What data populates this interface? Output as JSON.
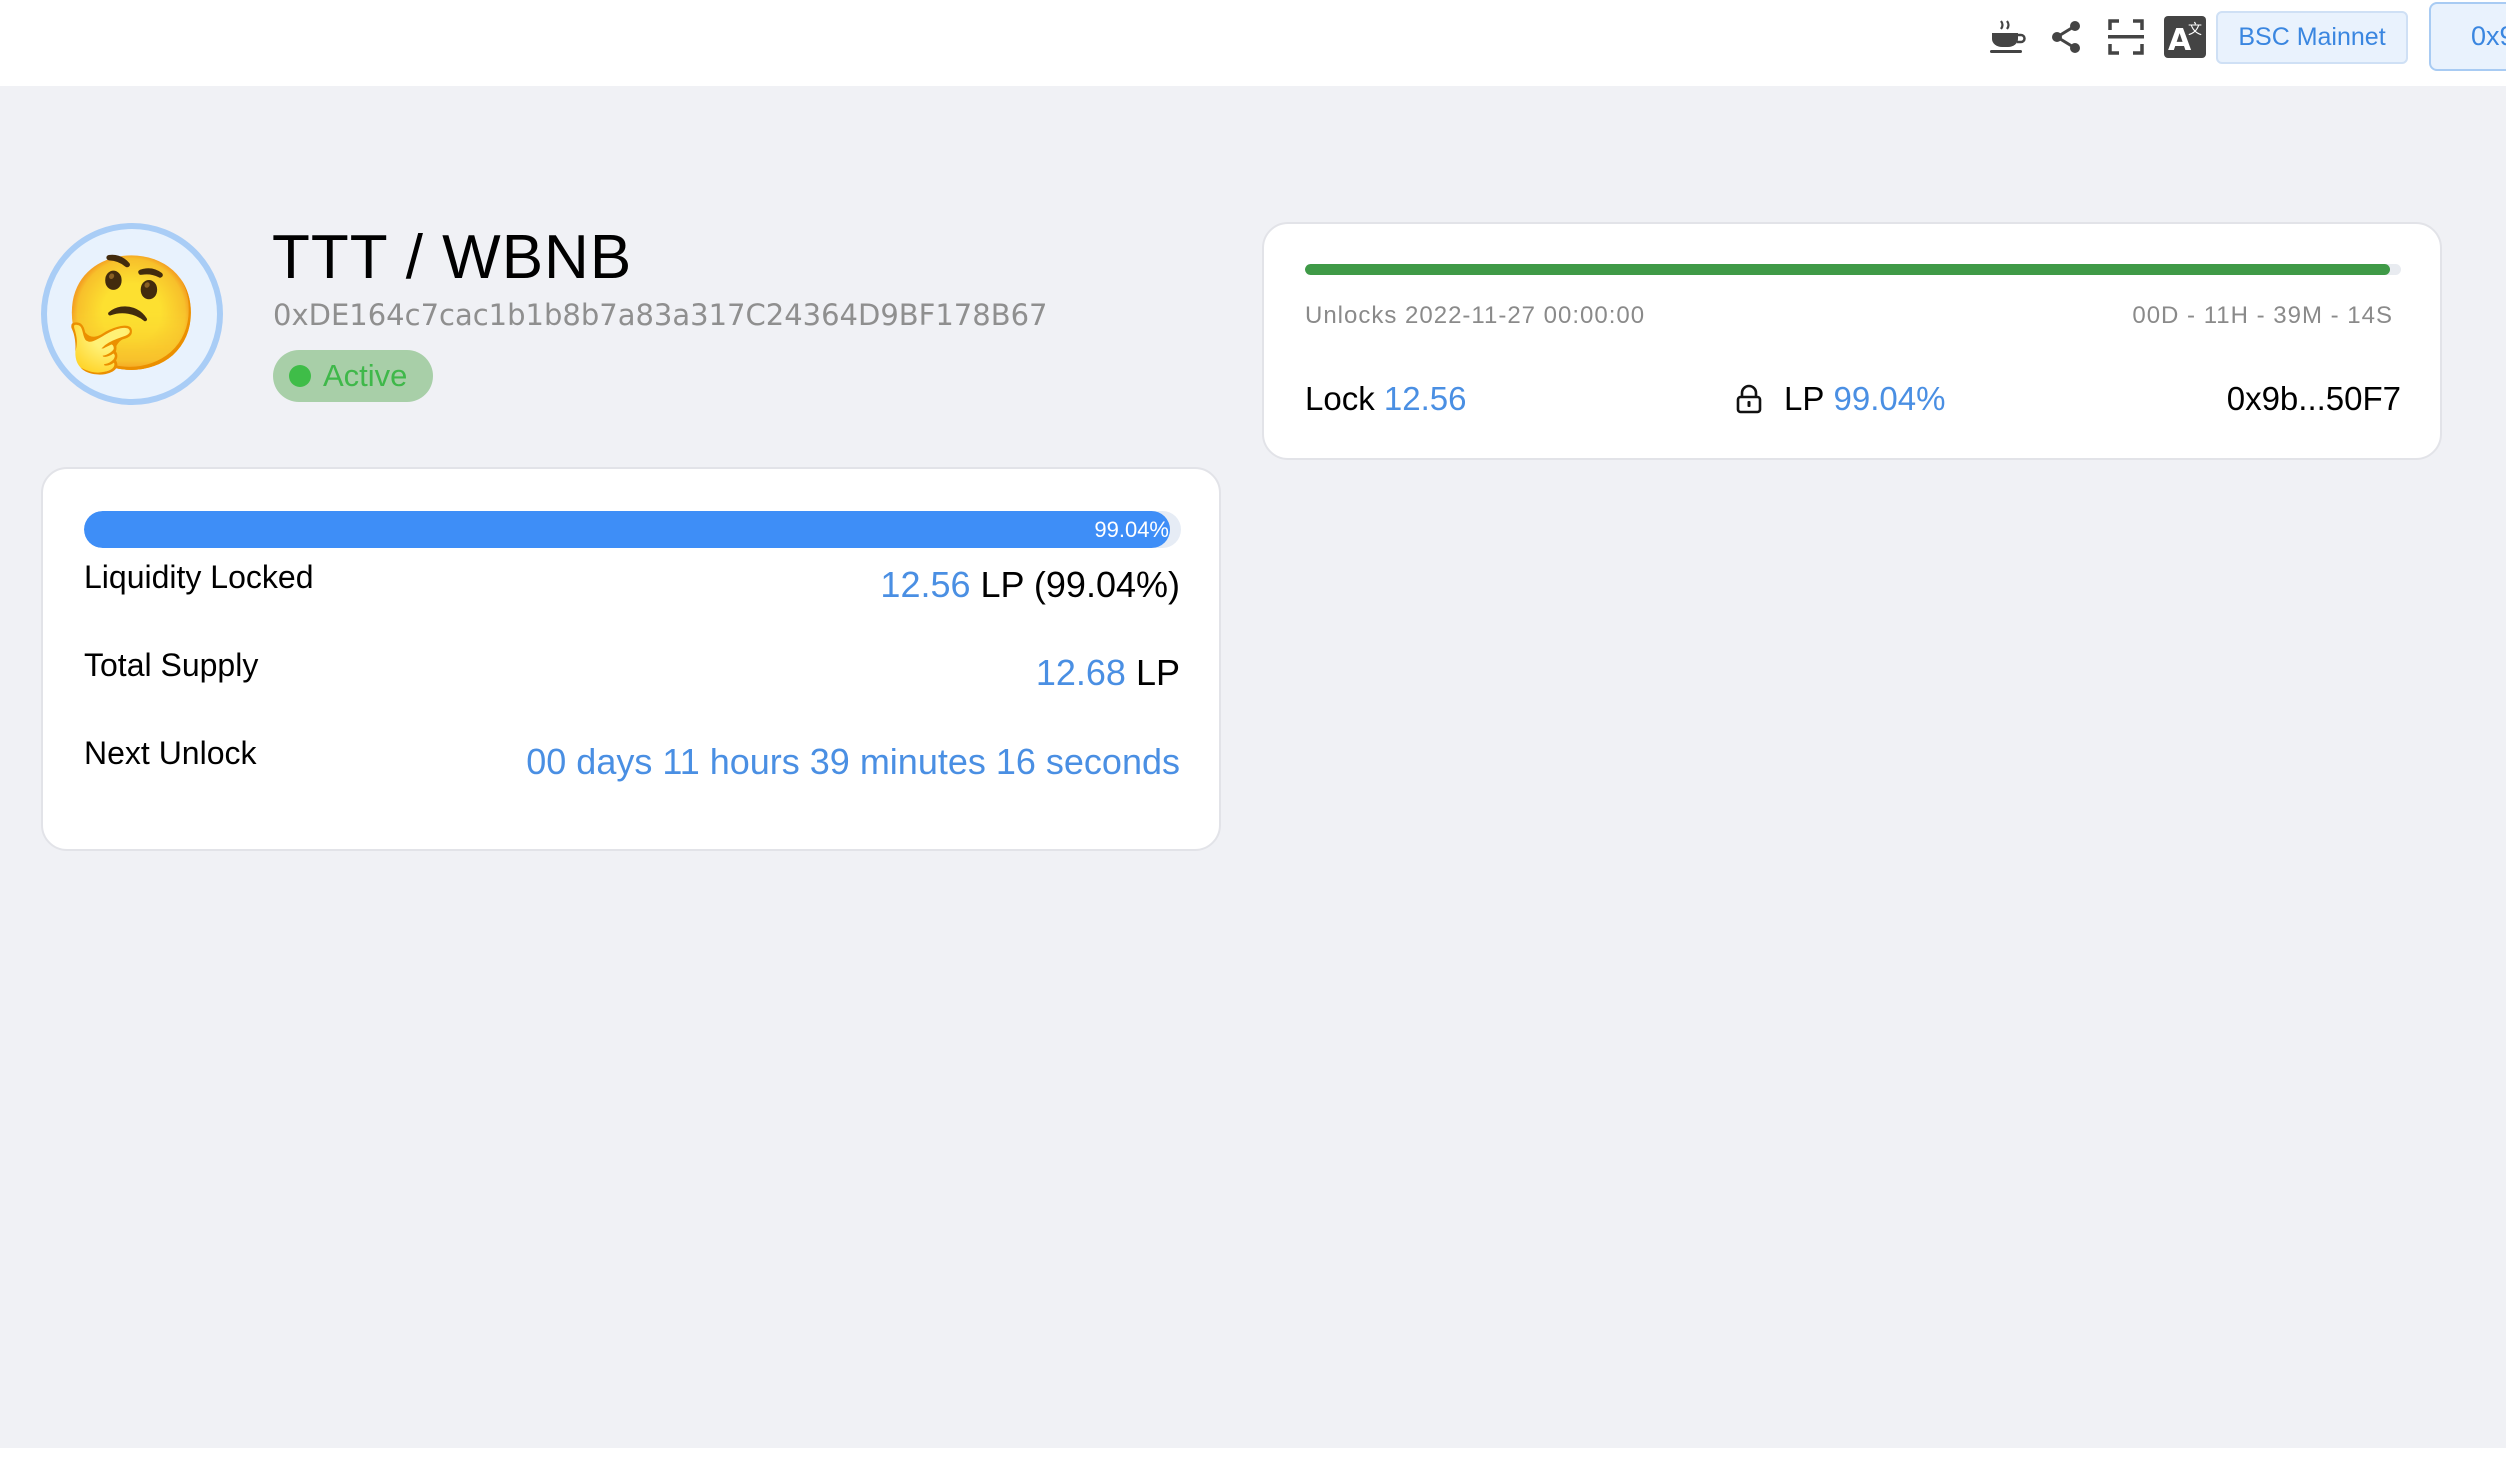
{
  "header": {
    "icons": [
      "coffee-icon",
      "share-icon",
      "fullscreen-icon",
      "translate-icon"
    ],
    "network_label": "BSC Mainnet",
    "wallet_label": "0x9"
  },
  "pair": {
    "title": "TTT / WBNB",
    "address": "0xDE164c7cac1b1b8b7a83a317C24364D9BF178B67",
    "status": "Active",
    "avatar_emoji": "🤔",
    "status_color": "#3fb84a"
  },
  "summary": {
    "progress_percent": 99.04,
    "progress_label": "99.04%",
    "rows": [
      {
        "label": "Liquidity Locked",
        "value": "12.56",
        "suffix": "LP (99.04%)"
      },
      {
        "label": "Total Supply",
        "value": "12.68",
        "suffix": "LP"
      },
      {
        "label": "Next Unlock",
        "value": "00 days 11 hours 39 minutes 16 seconds",
        "suffix": ""
      }
    ]
  },
  "lock": {
    "progress_percent": 99,
    "unlock_text": "Unlocks 2022-11-27 00:00:00",
    "countdown": "00D - 11H - 39M - 14S",
    "lock_label": "Lock",
    "lock_amount": "12.56",
    "lp_label": "LP",
    "lp_percent": "99.04%",
    "owner": "0x9b...50F7"
  },
  "colors": {
    "accent_blue": "#3e8ef7",
    "value_blue": "#4a8fe3",
    "lock_green": "#3f9a47",
    "background": "#f0f1f5"
  }
}
